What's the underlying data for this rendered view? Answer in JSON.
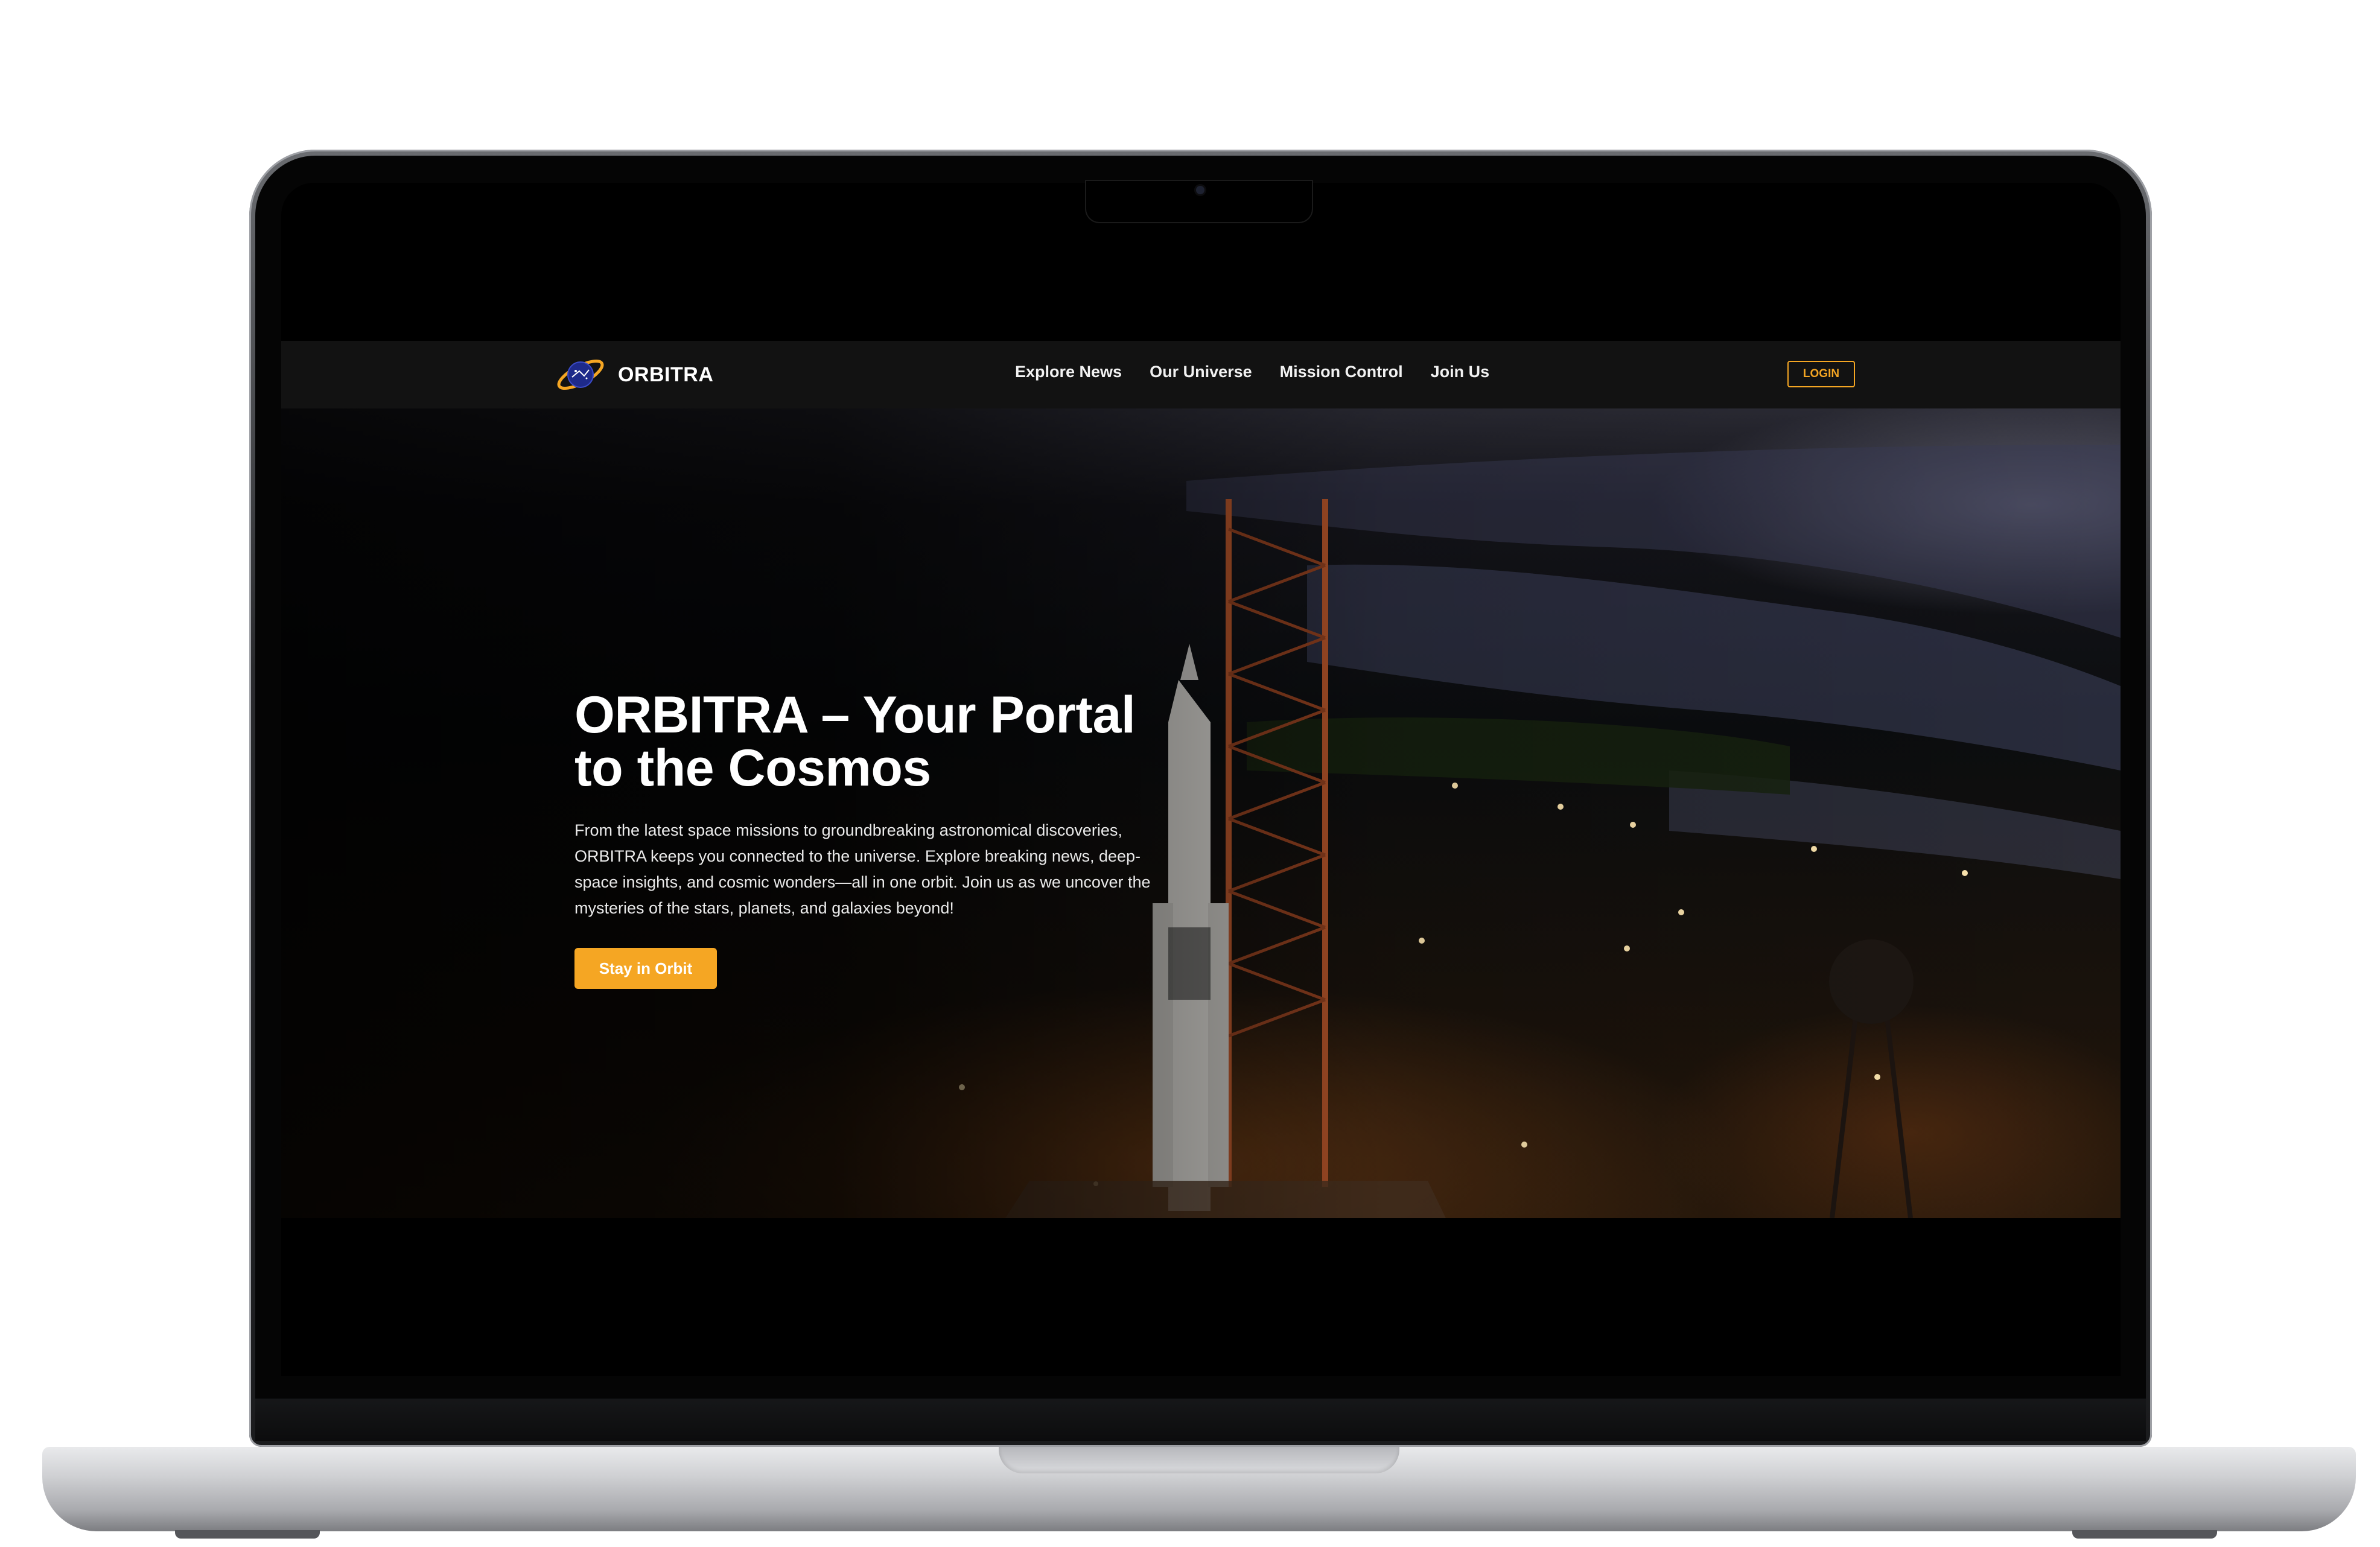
{
  "site": {
    "brand": "ORBITRA",
    "nav": [
      "Explore News",
      "Our Universe",
      "Mission Control",
      "Join Us"
    ],
    "login_label": "LOGIN"
  },
  "hero": {
    "title": "ORBITRA – Your Portal to the Cosmos",
    "description": "From the latest space missions to groundbreaking astronomical discoveries, ORBITRA keeps you connected to the universe. Explore breaking news, deep-space insights, and cosmic wonders—all in one orbit. Join us as we uncover the mysteries of the stars, planets, and galaxies beyond!",
    "cta_label": "Stay in Orbit",
    "background": "rocket-launch-pad-night-video"
  },
  "colors": {
    "accent": "#f5a623",
    "navbar": "#121212",
    "page_background": "#000000",
    "text": "#ffffff"
  }
}
